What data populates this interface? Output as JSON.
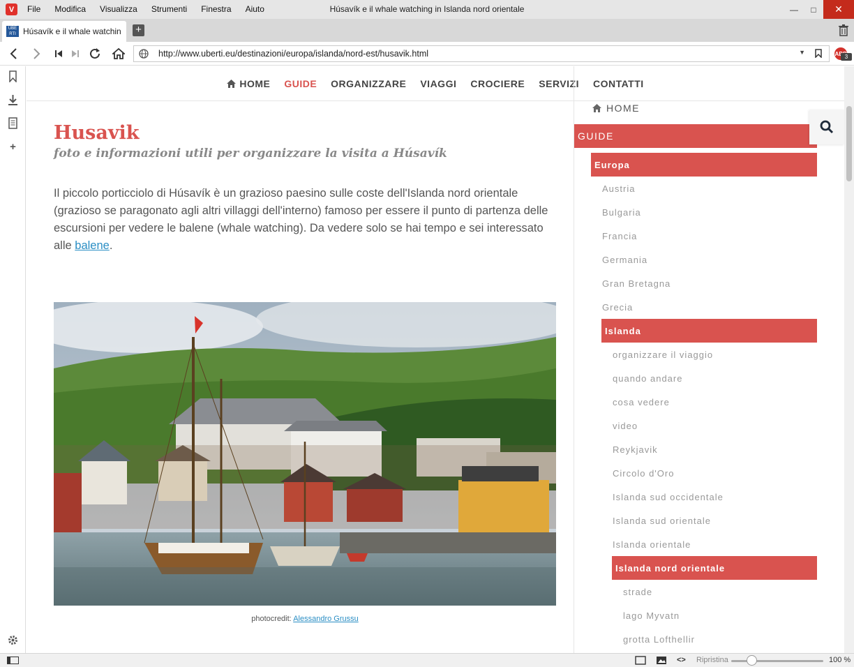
{
  "window": {
    "title": "Húsavík e il whale watching in Islanda nord orientale",
    "menu": [
      "File",
      "Modifica",
      "Visualizza",
      "Strumenti",
      "Finestra",
      "Aiuto"
    ]
  },
  "tab": {
    "title": "Húsavík e il whale watching in Islanda nord orientale",
    "favicon_text": "UBE RTI"
  },
  "address_bar": {
    "url": "http://www.uberti.eu/destinazioni/europa/islanda/nord-est/husavik.html"
  },
  "adblock": {
    "label": "ABP",
    "count": "3"
  },
  "site_nav": {
    "items": [
      {
        "label": "HOME",
        "active": false
      },
      {
        "label": "GUIDE",
        "active": true
      },
      {
        "label": "ORGANIZZARE",
        "active": false
      },
      {
        "label": "VIAGGI",
        "active": false
      },
      {
        "label": "CROCIERE",
        "active": false
      },
      {
        "label": "SERVIZI",
        "active": false
      },
      {
        "label": "CONTATTI",
        "active": false
      }
    ]
  },
  "article": {
    "title": "Husavik",
    "subtitle": "foto e informazioni utili per organizzare la visita a Húsavík",
    "intro_text": "Il piccolo porticciolo di Húsavík è un grazioso paesino sulle coste dell'Islanda nord orientale (grazioso se paragonato agli altri villaggi dell'interno) famoso per essere il punto di partenza delle escursioni per vedere le balene (whale watching). Da vedere solo se hai tempo e sei interessato alle",
    "intro_link": "balene",
    "intro_end": ".",
    "photo_credit_label": "photocredit:",
    "photo_credit_author": "Alessandro Grussu"
  },
  "sidebar": {
    "home": "HOME",
    "guide": "GUIDE",
    "europa": "Europa",
    "countries": [
      "Austria",
      "Bulgaria",
      "Francia",
      "Germania",
      "Gran Bretagna",
      "Grecia"
    ],
    "islanda": "Islanda",
    "islanda_items": [
      "organizzare il viaggio",
      "quando andare",
      "cosa vedere",
      "video",
      "Reykjavik",
      "Circolo d'Oro",
      "Islanda sud occidentale",
      "Islanda sud orientale",
      "Islanda orientale"
    ],
    "nord_orientale": "Islanda nord orientale",
    "nord_items": [
      "strade",
      "lago Myvatn",
      "grotta Lofthellir"
    ]
  },
  "status_bar": {
    "reset_label": "Ripristina",
    "zoom": "100 %",
    "zoom_fraction": 0.17
  },
  "colors": {
    "accent": "#d9534f",
    "link": "#2a8ec4",
    "browser_red": "#e0312b"
  }
}
